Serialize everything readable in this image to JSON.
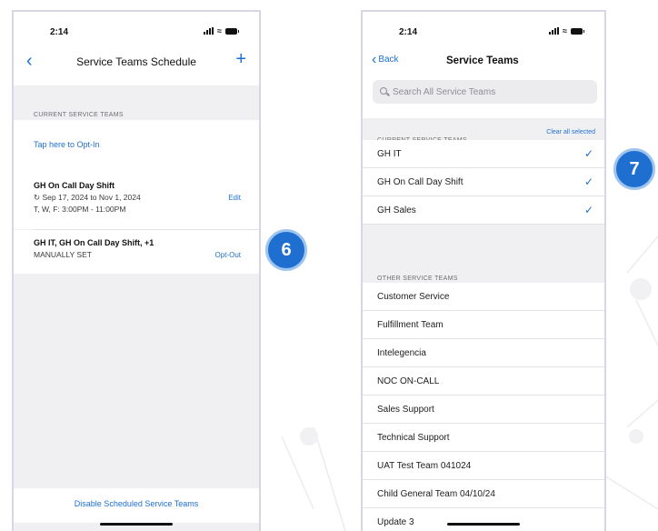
{
  "left_screen": {
    "status": {
      "time": "2:14"
    },
    "nav": {
      "title": "Service Teams Schedule",
      "add": "+"
    },
    "section_header": "CURRENT SERVICE TEAMS",
    "opt_in_link": "Tap here to Opt-In",
    "schedule_row": {
      "title": "GH On Call Day Shift",
      "dates": "Sep 17, 2024 to Nov 1, 2024",
      "days": "T, W, F: 3:00PM - 11:00PM",
      "edit": "Edit"
    },
    "manual_row": {
      "title": "GH IT, GH On Call Day Shift, +1",
      "subtitle": "MANUALLY SET",
      "action": "Opt-Out"
    },
    "disable_button": "Disable Scheduled Service Teams"
  },
  "badges": {
    "step6": "6",
    "step7": "7",
    "color": "#1f6fd1"
  },
  "right_screen": {
    "status": {
      "time": "2:14"
    },
    "nav": {
      "back": "Back",
      "title": "Service Teams"
    },
    "search": {
      "placeholder": "Search All Service Teams"
    },
    "current_header": "CURRENT SERVICE TEAMS",
    "clear_all": "Clear all selected",
    "current_teams": [
      "GH IT",
      "GH On Call Day Shift",
      "GH Sales"
    ],
    "other_header": "OTHER SERVICE TEAMS",
    "other_teams": [
      "Customer Service",
      "Fulfillment Team",
      "Intelegencia",
      "NOC ON-CALL",
      "Sales Support",
      "Technical Support",
      "UAT Test Team 041024",
      "Child General Team 04/10/24",
      "Update 3"
    ]
  },
  "accent_color": "#1f6fd1"
}
